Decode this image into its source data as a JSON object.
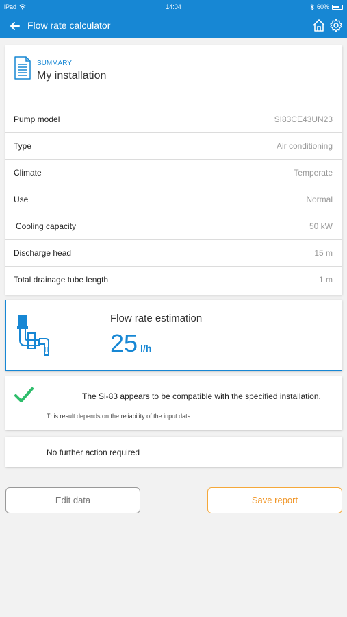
{
  "status_bar": {
    "device": "iPad",
    "time": "14:04",
    "battery": "60%"
  },
  "nav": {
    "title": "Flow rate calculator",
    "icons": [
      "back-arrow-icon",
      "home-icon",
      "gear-icon"
    ]
  },
  "summary": {
    "section_label": "SUMMARY",
    "title": "My installation",
    "rows": [
      {
        "label": "Pump model",
        "value": "SI83CE43UN23"
      },
      {
        "label": "Type",
        "value": "Air conditioning"
      },
      {
        "label": "Climate",
        "value": "Temperate"
      },
      {
        "label": "Use",
        "value": "Normal"
      },
      {
        "label": "Cooling capacity",
        "value": "50 kW"
      },
      {
        "label": "Discharge head",
        "value": "15 m"
      },
      {
        "label": "Total drainage tube length",
        "value": "1 m"
      }
    ]
  },
  "flow": {
    "title": "Flow rate estimation",
    "value": "25",
    "unit": "l/h"
  },
  "compatibility": {
    "message": "The Si-83 appears to be compatible with the specified installation.",
    "note": "This result depends on the reliability of the input data."
  },
  "action": {
    "text": "No further action required"
  },
  "buttons": {
    "edit": "Edit data",
    "save": "Save report"
  },
  "colors": {
    "accent": "#1787d4",
    "success": "#2ebd6b",
    "save": "#f09424"
  }
}
